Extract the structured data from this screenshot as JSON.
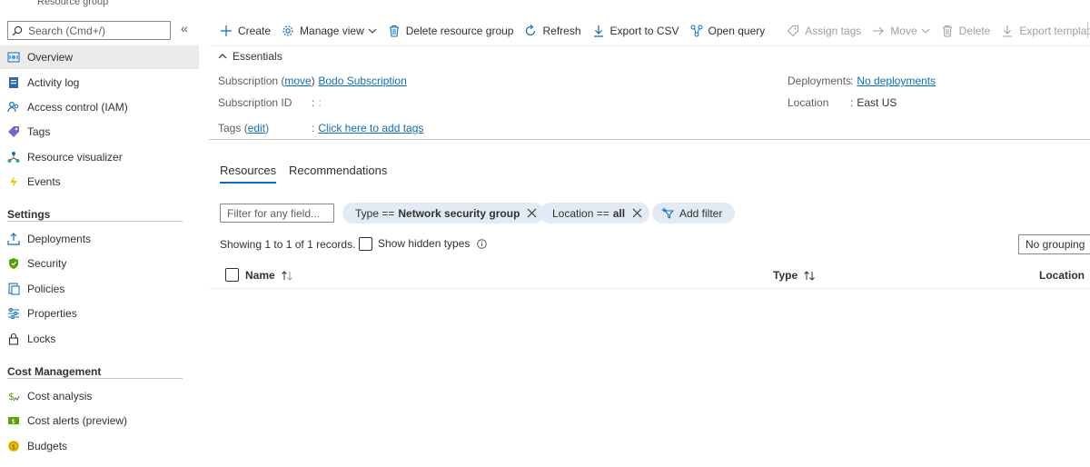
{
  "header": {
    "resource_type": "Resource group"
  },
  "sidebar": {
    "search_placeholder": "Search (Cmd+/)",
    "collapse_glyph": "«",
    "items": [
      {
        "label": "Overview",
        "icon": "overview-icon"
      },
      {
        "label": "Activity log",
        "icon": "activity-log-icon"
      },
      {
        "label": "Access control (IAM)",
        "icon": "people-icon"
      },
      {
        "label": "Tags",
        "icon": "tag-icon"
      },
      {
        "label": "Resource visualizer",
        "icon": "visualizer-icon"
      },
      {
        "label": "Events",
        "icon": "lightning-icon"
      }
    ],
    "settings_title": "Settings",
    "settings_items": [
      {
        "label": "Deployments",
        "icon": "upload-icon"
      },
      {
        "label": "Security",
        "icon": "shield-icon"
      },
      {
        "label": "Policies",
        "icon": "policy-icon"
      },
      {
        "label": "Properties",
        "icon": "sliders-icon"
      },
      {
        "label": "Locks",
        "icon": "lock-icon"
      }
    ],
    "cost_title": "Cost Management",
    "cost_items": [
      {
        "label": "Cost analysis",
        "icon": "cost-analysis-icon"
      },
      {
        "label": "Cost alerts (preview)",
        "icon": "cost-alert-icon"
      },
      {
        "label": "Budgets",
        "icon": "budget-icon"
      }
    ]
  },
  "toolbar": {
    "create": "Create",
    "manage_view": "Manage view",
    "delete_rg": "Delete resource group",
    "refresh": "Refresh",
    "export_csv": "Export to CSV",
    "open_query": "Open query",
    "assign_tags": "Assign tags",
    "move": "Move",
    "delete": "Delete",
    "export_template": "Export template"
  },
  "essentials": {
    "title": "Essentials",
    "subscription_label": "Subscription",
    "subscription_move": "move",
    "subscription_value": "Bodo Subscription",
    "subscription_id_label": "Subscription ID",
    "subscription_id_value": ":",
    "tags_label": "Tags",
    "tags_edit": "edit",
    "tags_value": "Click here to add tags",
    "deployments_label": "Deployments",
    "deployments_value": "No deployments",
    "location_label": "Location",
    "location_value": "East US"
  },
  "tabs": {
    "resources": "Resources",
    "recommendations": "Recommendations"
  },
  "filters": {
    "placeholder": "Filter for any field...",
    "type_prefix": "Type ==",
    "type_value": "Network security group",
    "location_prefix": "Location ==",
    "location_value": "all",
    "add_filter": "Add filter"
  },
  "records_text": "Showing 1 to 1 of 1 records.",
  "show_hidden_types": "Show hidden types",
  "grouping": "No grouping",
  "columns": {
    "name": "Name",
    "type": "Type",
    "location": "Location"
  },
  "colors": {
    "accent": "#0f6cbd",
    "active_bg": "#edebe9",
    "pill_bg": "#e1eaf5"
  }
}
